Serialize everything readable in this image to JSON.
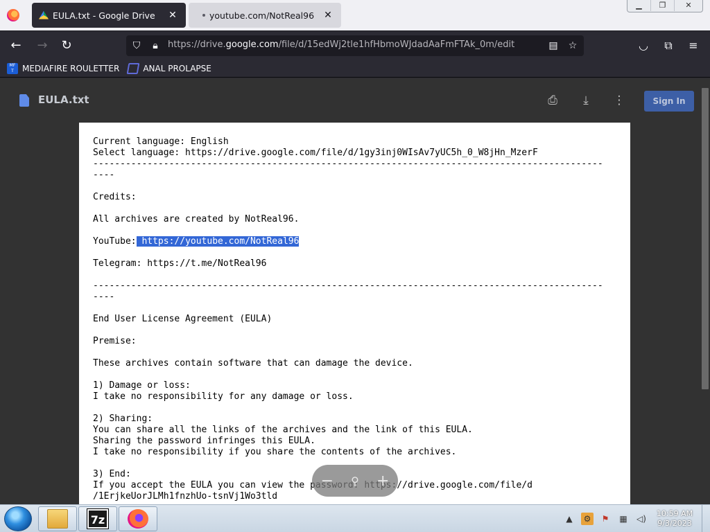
{
  "browser": {
    "tabs": [
      {
        "title": "EULA.txt - Google Drive",
        "active": true
      },
      {
        "title": "youtube.com/NotReal96",
        "active": false
      }
    ],
    "url": {
      "prefix": "https://drive.",
      "domain": "google.com",
      "path": "/file/d/15edWj2tle1hfHbmoWJdadAaFmFTAk_0m/edit"
    },
    "bookmarks": [
      {
        "label": "MEDIAFIRE ROULETTER",
        "icon": "MF\nT"
      },
      {
        "label": "ANAL PROLAPSE"
      }
    ]
  },
  "viewer": {
    "doc_title": "EULA.txt",
    "sign_in_label": "Sign In",
    "zoom": {
      "out": "−",
      "reset": "⚲",
      "in": "+"
    }
  },
  "document": {
    "before_highlight": "Current language: English\nSelect language: https://drive.google.com/file/d/1gy3inj0WIsAv7yUC5h_0_W8jHn_MzerF\n----------------------------------------------------------------------------------------------\n----\n\nCredits:\n\nAll archives are created by NotReal96.\n\nYouTube:",
    "highlight": " https://youtube.com/NotReal96",
    "after_highlight": "\n\nTelegram: https://t.me/NotReal96\n\n----------------------------------------------------------------------------------------------\n----\n\nEnd User License Agreement (EULA)\n\nPremise:\n\nThese archives contain software that can damage the device.\n\n1) Damage or loss:\nI take no responsibility for any damage or loss.\n\n2) Sharing:\nYou can share all the links of the archives and the link of this EULA.\nSharing the password infringes this EULA.\nI take no responsibility if you share the contents of the archives.\n\n3) End:\nIf you accept the EULA you can view the password: https://drive.google.com/file/d\n/1ErjkeUorJLMh1fnzhUo-tsnVj1Wo3tld"
  },
  "taskbar": {
    "apps": [
      "Windows Explorer",
      "7-Zip",
      "Firefox"
    ],
    "sevenzip_label": "7z",
    "clock": {
      "time": "10:59 AM",
      "date": "9/3/2023"
    }
  }
}
